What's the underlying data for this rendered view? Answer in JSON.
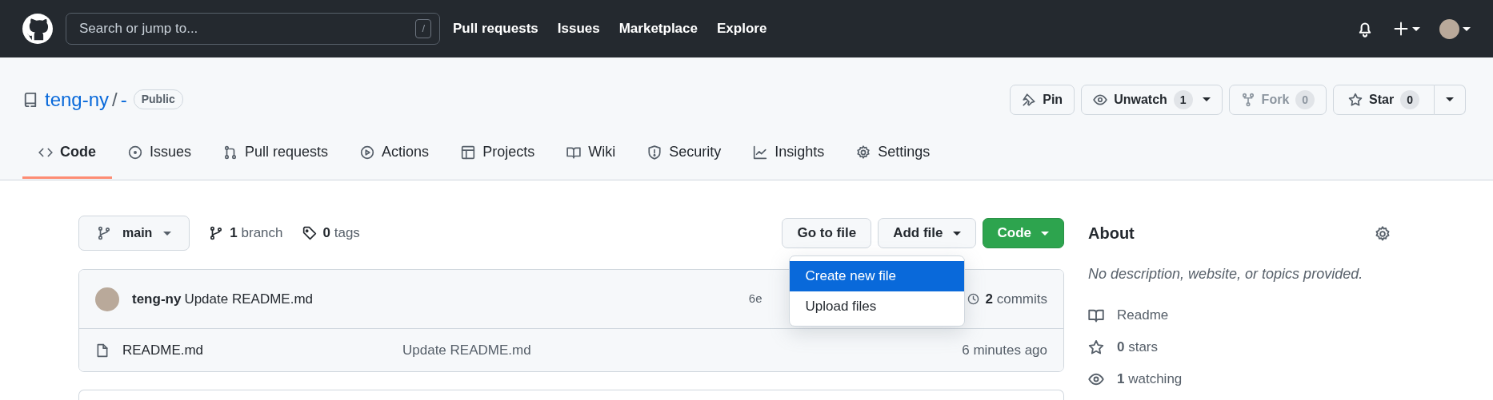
{
  "header": {
    "search_placeholder": "Search or jump to...",
    "search_key": "/",
    "nav": [
      "Pull requests",
      "Issues",
      "Marketplace",
      "Explore"
    ]
  },
  "repo": {
    "owner": "teng-ny",
    "separator": "/",
    "name": "-",
    "visibility": "Public",
    "actions": [
      {
        "label": "Pin",
        "caret": false,
        "disabled": false,
        "split_menu": false
      },
      {
        "label": "Unwatch",
        "count": "1",
        "caret": true,
        "disabled": false,
        "split_menu": false
      },
      {
        "label": "Fork",
        "count": "0",
        "caret": false,
        "disabled": true,
        "split_menu": false
      },
      {
        "label": "Star",
        "count": "0",
        "caret": false,
        "disabled": false,
        "split_menu": true
      }
    ]
  },
  "tabs": [
    {
      "label": "Code",
      "selected": true
    },
    {
      "label": "Issues",
      "selected": false
    },
    {
      "label": "Pull requests",
      "selected": false
    },
    {
      "label": "Actions",
      "selected": false
    },
    {
      "label": "Projects",
      "selected": false
    },
    {
      "label": "Wiki",
      "selected": false
    },
    {
      "label": "Security",
      "selected": false
    },
    {
      "label": "Insights",
      "selected": false
    },
    {
      "label": "Settings",
      "selected": false
    }
  ],
  "branch_button": {
    "name": "main"
  },
  "counts": [
    {
      "kind": "branch",
      "count": "1",
      "label": "branch"
    },
    {
      "kind": "tag",
      "count": "0",
      "label": "tags"
    }
  ],
  "file_buttons": [
    {
      "label": "Go to file",
      "kind": "plain",
      "caret": false
    },
    {
      "label": "Add file",
      "kind": "plain",
      "caret": true
    },
    {
      "label": "Code",
      "kind": "primary",
      "caret": true
    }
  ],
  "add_file_menu": [
    {
      "label": "Create new file",
      "selected": true
    },
    {
      "label": "Upload files",
      "selected": false
    }
  ],
  "latest_commit": {
    "author": "teng-ny",
    "message": "Update README.md",
    "sha": "6e",
    "commits_count": "2",
    "commits_label": "commits"
  },
  "files": [
    {
      "name": "README.md",
      "message": "Update README.md",
      "time": "6 minutes ago"
    }
  ],
  "about": {
    "title": "About",
    "description": "No description, website, or topics provided.",
    "links": [
      {
        "kind": "book",
        "label": "Readme"
      },
      {
        "kind": "star",
        "count": "0",
        "label": "stars"
      },
      {
        "kind": "eye",
        "count": "1",
        "label": "watching"
      }
    ]
  }
}
